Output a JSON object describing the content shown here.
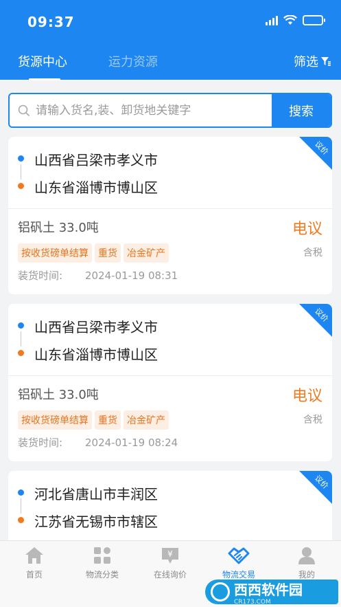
{
  "status_bar": {
    "time": "09:37"
  },
  "tabs": {
    "active": "货源中心",
    "inactive": "运力资源",
    "filter_label": "筛选"
  },
  "search": {
    "placeholder": "请输入货名,装、卸货地关键字",
    "value": "",
    "button_label": "搜索"
  },
  "cards": [
    {
      "corner_badge": "议价",
      "from": "山西省吕梁市孝义市",
      "to": "山东省淄博市博山区",
      "goods": "铝矾土 33.0吨",
      "price": "电议",
      "tax": "含税",
      "tags": [
        "按收货磅单结算",
        "重货",
        "冶金矿产"
      ],
      "load_label": "装货时间:",
      "load_time": "2024-01-19 08:31"
    },
    {
      "corner_badge": "议价",
      "from": "山西省吕梁市孝义市",
      "to": "山东省淄博市博山区",
      "goods": "铝矾土 33.0吨",
      "price": "电议",
      "tax": "含税",
      "tags": [
        "按收货磅单结算",
        "重货",
        "冶金矿产"
      ],
      "load_label": "装货时间:",
      "load_time": "2024-01-19 08:24"
    },
    {
      "corner_badge": "议价",
      "from": "河北省唐山市丰润区",
      "to": "江苏省无锡市市辖区"
    }
  ],
  "tabbar": [
    {
      "label": "首页",
      "icon": "home-icon"
    },
    {
      "label": "物流分类",
      "icon": "category-grid-icon"
    },
    {
      "label": "在线询价",
      "icon": "price-inquiry-icon"
    },
    {
      "label": "物流交易",
      "icon": "handshake-icon",
      "active": true
    },
    {
      "label": "我的",
      "icon": "user-icon"
    }
  ],
  "watermark": {
    "title": "西西软件园",
    "subtitle": "CR173.COM"
  },
  "colors": {
    "primary": "#1e86f0",
    "accent": "#f2791c",
    "tag_bg": "#fdeee3"
  }
}
